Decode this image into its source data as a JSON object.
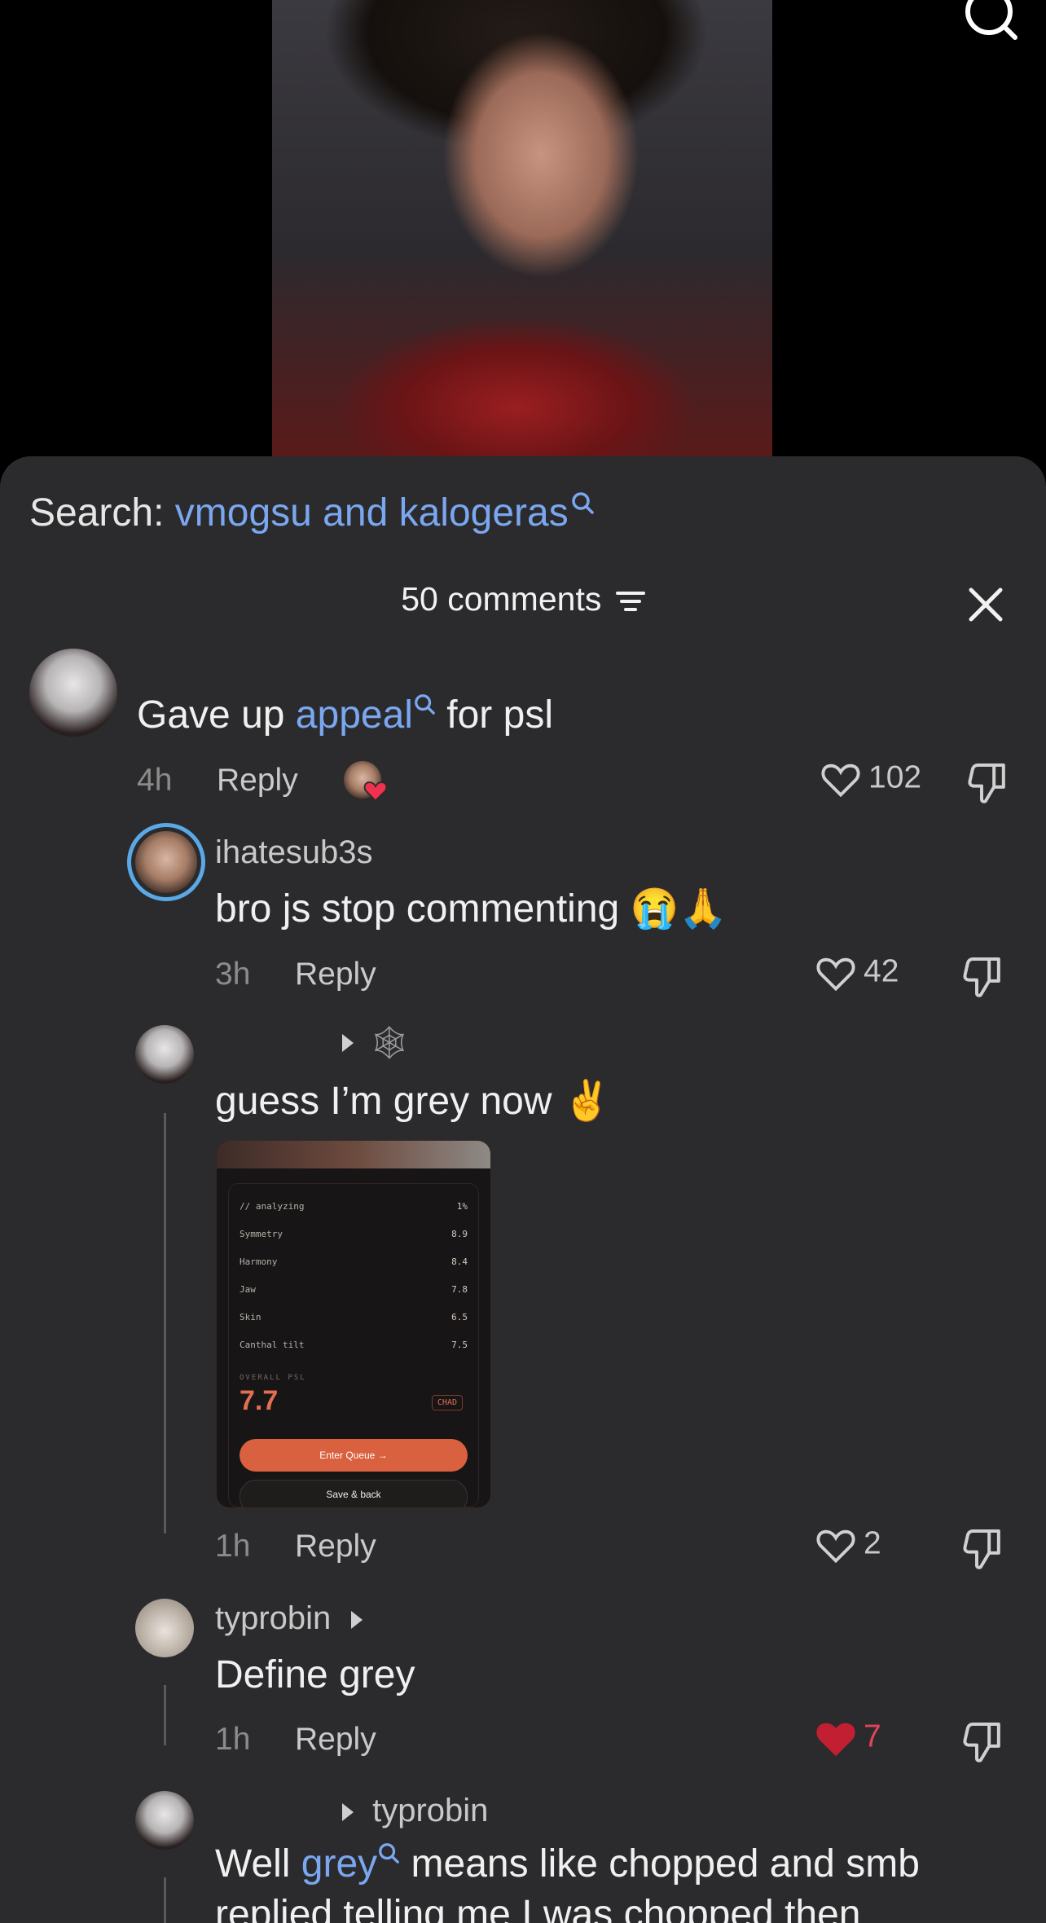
{
  "search": {
    "prefix": "Search: ",
    "query": "vmogsu and kalogeras"
  },
  "header": {
    "count_label": "50 comments"
  },
  "comments": [
    {
      "text_parts": [
        "Gave up ",
        "appeal",
        " for psl"
      ],
      "time": "4h",
      "reply": "Reply",
      "likes": "102"
    },
    {
      "user": "ihatesub3s",
      "text": "bro js stop commenting 😭🙏",
      "time": "3h",
      "reply": "Reply",
      "likes": "42"
    },
    {
      "user_emoji": "🕸",
      "text": "guess I’m grey now ✌️",
      "time": "1h",
      "reply": "Reply",
      "likes": "2",
      "attachment": {
        "header": "// analyzing",
        "progress": "1%",
        "rows": [
          {
            "label": "Symmetry",
            "value": "8.9"
          },
          {
            "label": "Harmony",
            "value": "8.4"
          },
          {
            "label": "Jaw",
            "value": "7.8"
          },
          {
            "label": "Skin",
            "value": "6.5"
          },
          {
            "label": "Canthal tilt",
            "value": "7.5"
          }
        ],
        "overall_label": "OVERALL PSL",
        "overall_value": "7.7",
        "tag": "CHAD",
        "primary_button": "Enter Queue →",
        "secondary_button": "Save & back"
      }
    },
    {
      "user": "typrobin",
      "text": "Define grey",
      "time": "1h",
      "reply": "Reply",
      "likes": "7",
      "liked": true
    },
    {
      "reply_to": "typrobin",
      "text_parts": [
        "Well ",
        "grey",
        " means like chopped and smb"
      ],
      "text_line2": "replied telling me I was chopped then"
    }
  ],
  "colors": {
    "link": "#7aa7f0",
    "sheet_bg": "#2b2b2d",
    "liked": "#e0435a"
  }
}
